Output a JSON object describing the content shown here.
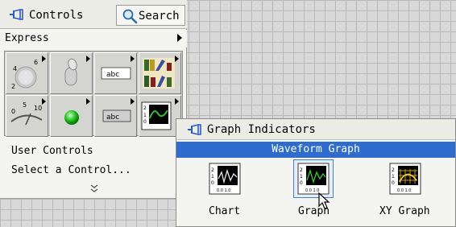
{
  "palette": {
    "title": "Controls",
    "search_label": "Search",
    "category": "Express",
    "items": [
      "User Controls",
      "Select a Control..."
    ],
    "expand_glyph": "»"
  },
  "graph_indicators": {
    "title": "Graph Indicators",
    "highlight_label": "Waveform Graph",
    "icons": [
      {
        "label": "Chart",
        "icon": "waveform-chart-icon"
      },
      {
        "label": "Graph",
        "icon": "waveform-graph-icon",
        "selected": true
      },
      {
        "label": "XY Graph",
        "icon": "xy-graph-icon"
      }
    ]
  },
  "colors": {
    "highlight_bar": "#2f6cd0",
    "palette_bg": "#f4f4f0",
    "canvas_grid": "#b8b8b8"
  }
}
